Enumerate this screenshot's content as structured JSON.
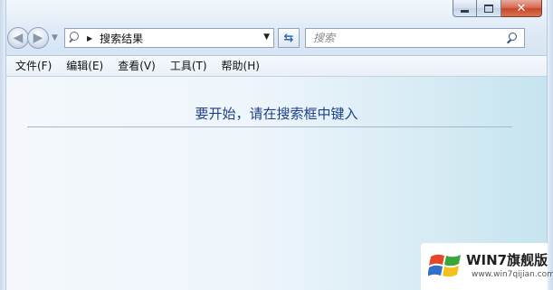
{
  "window": {
    "caption_buttons": {
      "minimize": "minimize",
      "maximize": "maximize",
      "close": "close"
    }
  },
  "navigation": {
    "back_icon": "back-arrow",
    "forward_icon": "forward-arrow",
    "history_dropdown_icon": "chevron-down"
  },
  "address_bar": {
    "icon": "search-icon",
    "separator_icon": "right-triangle",
    "path": "搜索结果",
    "dropdown_icon": "chevron-down"
  },
  "refresh": {
    "icon": "refresh-arrows"
  },
  "search": {
    "placeholder": "搜索",
    "value": ""
  },
  "menu": {
    "items": [
      {
        "label": "文件(F)"
      },
      {
        "label": "编辑(E)"
      },
      {
        "label": "查看(V)"
      },
      {
        "label": "工具(T)"
      },
      {
        "label": "帮助(H)"
      }
    ]
  },
  "content": {
    "hint": "要开始，请在搜索框中键入"
  },
  "watermark": {
    "title": "WIN7旗舰版",
    "url": "www.win7qijian.com"
  },
  "colors": {
    "hint_text": "#1e3f8a",
    "close_button": "#c6472c",
    "accent": "#2b66b0"
  }
}
